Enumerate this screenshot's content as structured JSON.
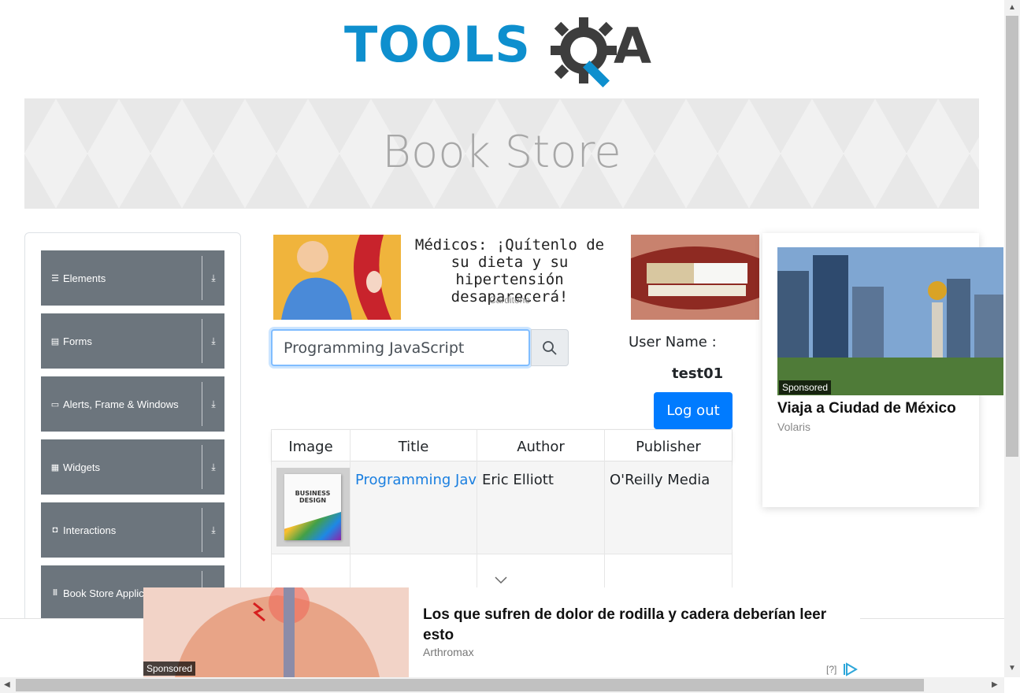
{
  "logo": {
    "text": "TOOLS",
    "suffix": "A"
  },
  "banner": {
    "title": "Book Store"
  },
  "menu": {
    "groups": [
      {
        "label": "Elements",
        "icon": "hamburger-icon"
      },
      {
        "label": "Forms",
        "icon": "form-icon"
      },
      {
        "label": "Alerts, Frame & Windows",
        "icon": "window-icon"
      },
      {
        "label": "Widgets",
        "icon": "grid-icon"
      },
      {
        "label": "Interactions",
        "icon": "interactions-icon"
      },
      {
        "label": "Book Store Application",
        "icon": "books-icon"
      }
    ]
  },
  "ad_top": {
    "title": "Médicos: ¡Quítenlo de su dieta y su hipertensión desaparecerá!",
    "source": "Carditone"
  },
  "search": {
    "value": "Programming JavaScript"
  },
  "user": {
    "label": "User Name :",
    "value": "test01",
    "logout_label": "Log out"
  },
  "table": {
    "headers": [
      "Image",
      "Title",
      "Author",
      "Publisher"
    ],
    "rows": [
      {
        "title": "Programming JavaScript Applications",
        "author": "Eric Elliott",
        "publisher": "O'Reilly Media",
        "cover_text": "BUSINESS DESIGN"
      }
    ]
  },
  "ad_right": {
    "badge": "Sponsored",
    "title": "Viaja a Ciudad de México",
    "source": "Volaris"
  },
  "ad_bottom": {
    "badge": "Sponsored",
    "title": "Los que sufren de dolor de rodilla y cadera deberían leer esto",
    "source": "Arthromax",
    "help": "[?]"
  },
  "colors": {
    "brand_blue": "#0e8fce",
    "menu_gray": "#6c757d",
    "primary": "#007bff",
    "link": "#1a7fe0"
  }
}
